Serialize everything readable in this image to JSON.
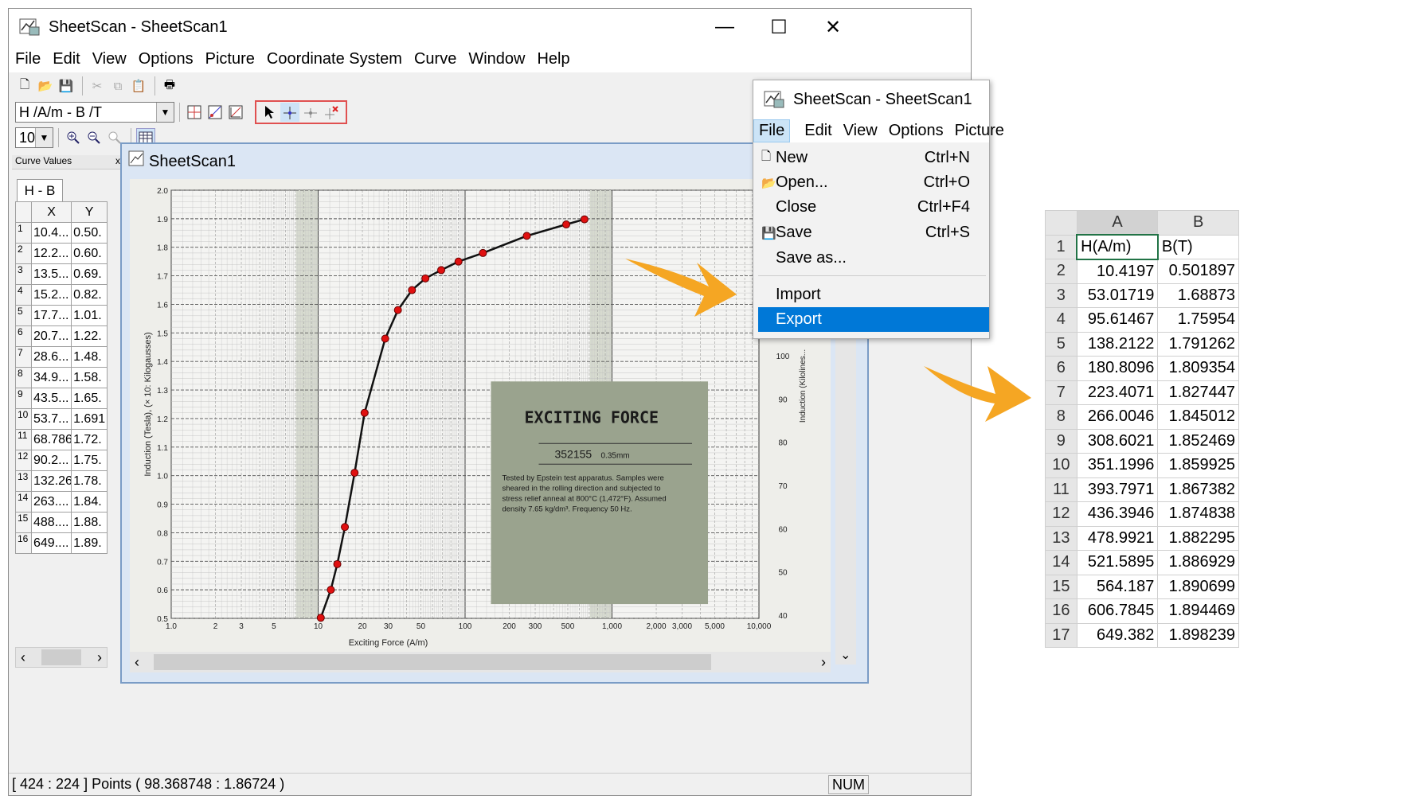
{
  "main_window": {
    "title": "SheetScan - SheetScan1",
    "menu": [
      "File",
      "Edit",
      "View",
      "Options",
      "Picture",
      "Coordinate System",
      "Curve",
      "Window",
      "Help"
    ],
    "curve_selector": "H /A/m  -  B /T",
    "zoom_value": "10"
  },
  "curve_panel": {
    "header": "Curve Values",
    "close": "x",
    "tab_label": "H - B",
    "col_x": "X",
    "col_y": "Y",
    "rows": [
      {
        "n": "1",
        "x": "10.4...",
        "y": "0.50."
      },
      {
        "n": "2",
        "x": "12.2...",
        "y": "0.60."
      },
      {
        "n": "3",
        "x": "13.5...",
        "y": "0.69."
      },
      {
        "n": "4",
        "x": "15.2...",
        "y": "0.82."
      },
      {
        "n": "5",
        "x": "17.7...",
        "y": "1.01."
      },
      {
        "n": "6",
        "x": "20.7...",
        "y": "1.22."
      },
      {
        "n": "7",
        "x": "28.6...",
        "y": "1.48."
      },
      {
        "n": "8",
        "x": "34.9...",
        "y": "1.58."
      },
      {
        "n": "9",
        "x": "43.5...",
        "y": "1.65."
      },
      {
        "n": "10",
        "x": "53.7...",
        "y": "1.691"
      },
      {
        "n": "11",
        "x": "68.786",
        "y": "1.72."
      },
      {
        "n": "12",
        "x": "90.2...",
        "y": "1.75."
      },
      {
        "n": "13",
        "x": "132.26",
        "y": "1.78."
      },
      {
        "n": "14",
        "x": "263....",
        "y": "1.84."
      },
      {
        "n": "15",
        "x": "488....",
        "y": "1.88."
      },
      {
        "n": "16",
        "x": "649....",
        "y": "1.89."
      }
    ]
  },
  "doc_window": {
    "title": "SheetScan1"
  },
  "chart_data": {
    "type": "line",
    "xlabel": "Exciting Force (A/m)",
    "ylabel": "Induction (Tesla), (× 10: Kilogausses)",
    "right_label": "Induction (Kilolines...",
    "x_scale": "log",
    "xlim": [
      1,
      10000
    ],
    "ylim": [
      0.5,
      2.0
    ],
    "x_ticks": [
      "1.0",
      "2",
      "3",
      "5",
      "10",
      "20",
      "30",
      "50",
      "100",
      "200",
      "300",
      "500",
      "1,000",
      "2,000",
      "3,000",
      "5,000",
      "10,000"
    ],
    "y_ticks": [
      "0.5",
      "0.6",
      "0.7",
      "0.8",
      "0.9",
      "1.0",
      "1.1",
      "1.2",
      "1.3",
      "1.4",
      "1.5",
      "1.6",
      "1.7",
      "1.8",
      "1.9",
      "2.0"
    ],
    "right_ticks": [
      "100",
      "90",
      "80",
      "70",
      "60",
      "50",
      "40"
    ],
    "series": [
      {
        "values": [
          [
            10.42,
            0.502
          ],
          [
            12.2,
            0.6
          ],
          [
            13.5,
            0.69
          ],
          [
            15.2,
            0.82
          ],
          [
            17.7,
            1.01
          ],
          [
            20.7,
            1.22
          ],
          [
            28.6,
            1.48
          ],
          [
            34.9,
            1.58
          ],
          [
            43.5,
            1.65
          ],
          [
            53.7,
            1.691
          ],
          [
            68.786,
            1.72
          ],
          [
            90.2,
            1.75
          ],
          [
            132.26,
            1.78
          ],
          [
            263,
            1.84
          ],
          [
            488,
            1.88
          ],
          [
            649.382,
            1.898
          ]
        ]
      }
    ],
    "annotation": {
      "title": "EXCITING FORCE",
      "code": "352155",
      "thickness": "0.35mm",
      "text_lines": [
        "Tested by Epstein test apparatus. Samples were",
        "sheared in the rolling direction and subjected to",
        "stress relief anneal at 800°C (1,472°F). Assumed",
        "density 7.65 kg/dm³. Frequency 50 Hz."
      ]
    }
  },
  "status": {
    "coords": "[ 424 : 224 ] Points (  98.368748 :  1.86724 )",
    "num": "NUM"
  },
  "file_window": {
    "title": "SheetScan - SheetScan1",
    "menu": [
      "File",
      "Edit",
      "View",
      "Options",
      "Picture"
    ],
    "items": [
      {
        "label": "New",
        "shortcut": "Ctrl+N"
      },
      {
        "label": "Open...",
        "shortcut": "Ctrl+O"
      },
      {
        "label": "Close",
        "shortcut": "Ctrl+F4"
      },
      {
        "label": "Save",
        "shortcut": "Ctrl+S"
      },
      {
        "label": "Save as...",
        "shortcut": ""
      },
      {
        "label": "Import",
        "shortcut": ""
      },
      {
        "label": "Export",
        "shortcut": ""
      }
    ]
  },
  "spreadsheet": {
    "col_a": "A",
    "col_b": "B",
    "rows": [
      {
        "n": "1",
        "a": "H(A/m)",
        "b": "B(T)"
      },
      {
        "n": "2",
        "a": "10.4197",
        "b": "0.501897"
      },
      {
        "n": "3",
        "a": "53.01719",
        "b": "1.68873"
      },
      {
        "n": "4",
        "a": "95.61467",
        "b": "1.75954"
      },
      {
        "n": "5",
        "a": "138.2122",
        "b": "1.791262"
      },
      {
        "n": "6",
        "a": "180.8096",
        "b": "1.809354"
      },
      {
        "n": "7",
        "a": "223.4071",
        "b": "1.827447"
      },
      {
        "n": "8",
        "a": "266.0046",
        "b": "1.845012"
      },
      {
        "n": "9",
        "a": "308.6021",
        "b": "1.852469"
      },
      {
        "n": "10",
        "a": "351.1996",
        "b": "1.859925"
      },
      {
        "n": "11",
        "a": "393.7971",
        "b": "1.867382"
      },
      {
        "n": "12",
        "a": "436.3946",
        "b": "1.874838"
      },
      {
        "n": "13",
        "a": "478.9921",
        "b": "1.882295"
      },
      {
        "n": "14",
        "a": "521.5895",
        "b": "1.886929"
      },
      {
        "n": "15",
        "a": "564.187",
        "b": "1.890699"
      },
      {
        "n": "16",
        "a": "606.7845",
        "b": "1.894469"
      },
      {
        "n": "17",
        "a": "649.382",
        "b": "1.898239"
      }
    ]
  },
  "colors": {
    "accent": "#0078d7",
    "marker": "#e01010",
    "arrow": "#f5a623",
    "highlight": "#e05050"
  }
}
